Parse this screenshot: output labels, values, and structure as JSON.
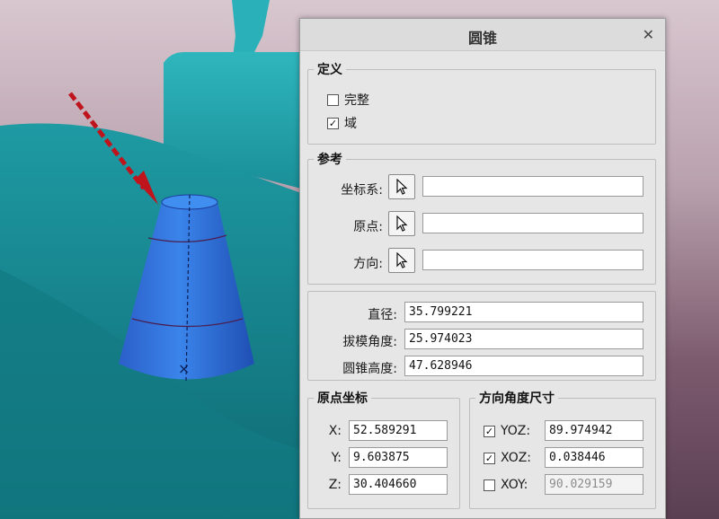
{
  "dialog": {
    "title": "圆锥",
    "close_glyph": "✕"
  },
  "definition": {
    "legend": "定义",
    "options": [
      {
        "label": "完整",
        "checked": false
      },
      {
        "label": "域",
        "checked": true
      }
    ]
  },
  "reference": {
    "legend": "参考",
    "rows": [
      {
        "label": "坐标系:",
        "icon": "pointer-arrow-icon",
        "value": ""
      },
      {
        "label": "原点:",
        "icon": "pointer-arrow-icon",
        "value": ""
      },
      {
        "label": "方向:",
        "icon": "pointer-arrow-icon",
        "value": ""
      }
    ]
  },
  "dimensions": {
    "rows": [
      {
        "label": "直径:",
        "value": "35.799221"
      },
      {
        "label": "拔模角度:",
        "value": "25.974023"
      },
      {
        "label": "圆锥高度:",
        "value": "47.628946"
      }
    ]
  },
  "origin": {
    "legend": "原点坐标",
    "rows": [
      {
        "label": "X:",
        "value": "52.589291"
      },
      {
        "label": "Y:",
        "value": "9.603875"
      },
      {
        "label": "Z:",
        "value": "30.404660"
      }
    ]
  },
  "direction": {
    "legend": "方向角度尺寸",
    "rows": [
      {
        "label": "YOZ:",
        "checked": true,
        "value": "89.974942",
        "enabled": true
      },
      {
        "label": "XOZ:",
        "checked": true,
        "value": "0.038446",
        "enabled": true
      },
      {
        "label": "XOY:",
        "checked": false,
        "value": "90.029159",
        "enabled": false
      }
    ]
  },
  "colors": {
    "model_teal": "#1f9aa3",
    "cone_blue": "#2a6fd6",
    "arrow_red": "#c0141c",
    "dialog_bg": "#e6e6e6"
  },
  "checkmark_glyph": "✓"
}
